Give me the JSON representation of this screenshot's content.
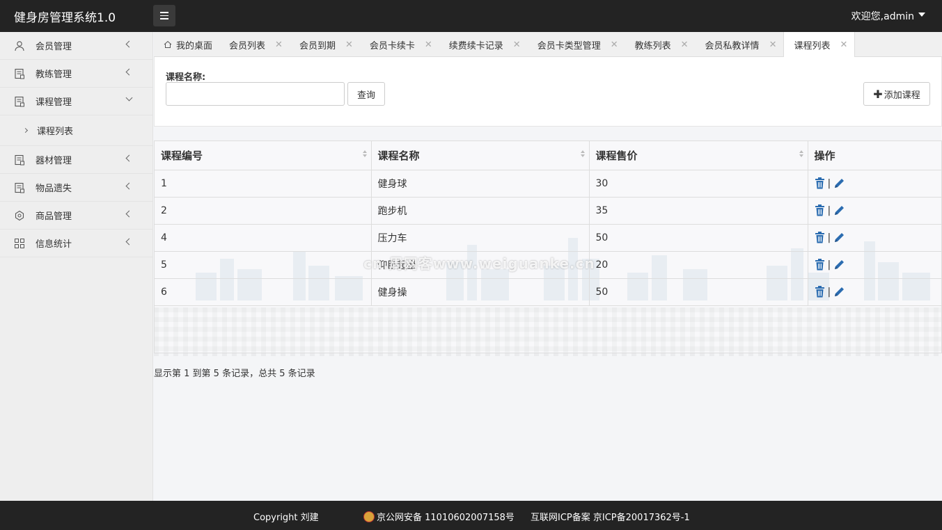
{
  "header": {
    "brand": "健身房管理系统1.0",
    "user": "欢迎您,admin"
  },
  "sidebar": {
    "items": [
      {
        "label": "会员管理",
        "icon": "user-icon"
      },
      {
        "label": "教练管理",
        "icon": "document-icon"
      },
      {
        "label": "课程管理",
        "icon": "document-icon",
        "expanded": true
      },
      {
        "label": "器材管理",
        "icon": "document-icon"
      },
      {
        "label": "物品遗失",
        "icon": "document-icon"
      },
      {
        "label": "商品管理",
        "icon": "shopping-icon"
      },
      {
        "label": "信息统计",
        "icon": "grid-icon"
      }
    ],
    "sub_item": "课程列表"
  },
  "tabs": [
    {
      "label": "我的桌面",
      "closable": false
    },
    {
      "label": "会员列表",
      "closable": true
    },
    {
      "label": "会员到期",
      "closable": true
    },
    {
      "label": "会员卡续卡",
      "closable": true
    },
    {
      "label": "续费续卡记录",
      "closable": true
    },
    {
      "label": "会员卡类型管理",
      "closable": true
    },
    {
      "label": "教练列表",
      "closable": true
    },
    {
      "label": "会员私教详情",
      "closable": true
    },
    {
      "label": "课程列表",
      "closable": true,
      "active": true
    }
  ],
  "search": {
    "label": "课程名称:",
    "value": "",
    "query_button": "查询",
    "add_button": "添加课程"
  },
  "table": {
    "columns": [
      "课程编号",
      "课程名称",
      "课程售价",
      "操作"
    ],
    "rows": [
      {
        "id": "1",
        "name": "健身球",
        "price": "30"
      },
      {
        "id": "2",
        "name": "跑步机",
        "price": "35"
      },
      {
        "id": "4",
        "name": "压力车",
        "price": "50"
      },
      {
        "id": "5",
        "name": "仰卧起坐",
        "price": "20"
      },
      {
        "id": "6",
        "name": "健身操",
        "price": "50"
      }
    ],
    "op_separator": "|"
  },
  "summary": "显示第 1 到第 5 条记录，总共 5 条记录",
  "watermark": "cn.周网客www.weiguanke.cn",
  "footer": {
    "copyright": "Copyright 刘建",
    "police": "京公网安备 11010602007158号",
    "icp": "互联网ICP备案 京ICP备20017362号-1"
  },
  "colors": {
    "header_bg": "#232323",
    "icon_blue": "#2b6cb0"
  }
}
